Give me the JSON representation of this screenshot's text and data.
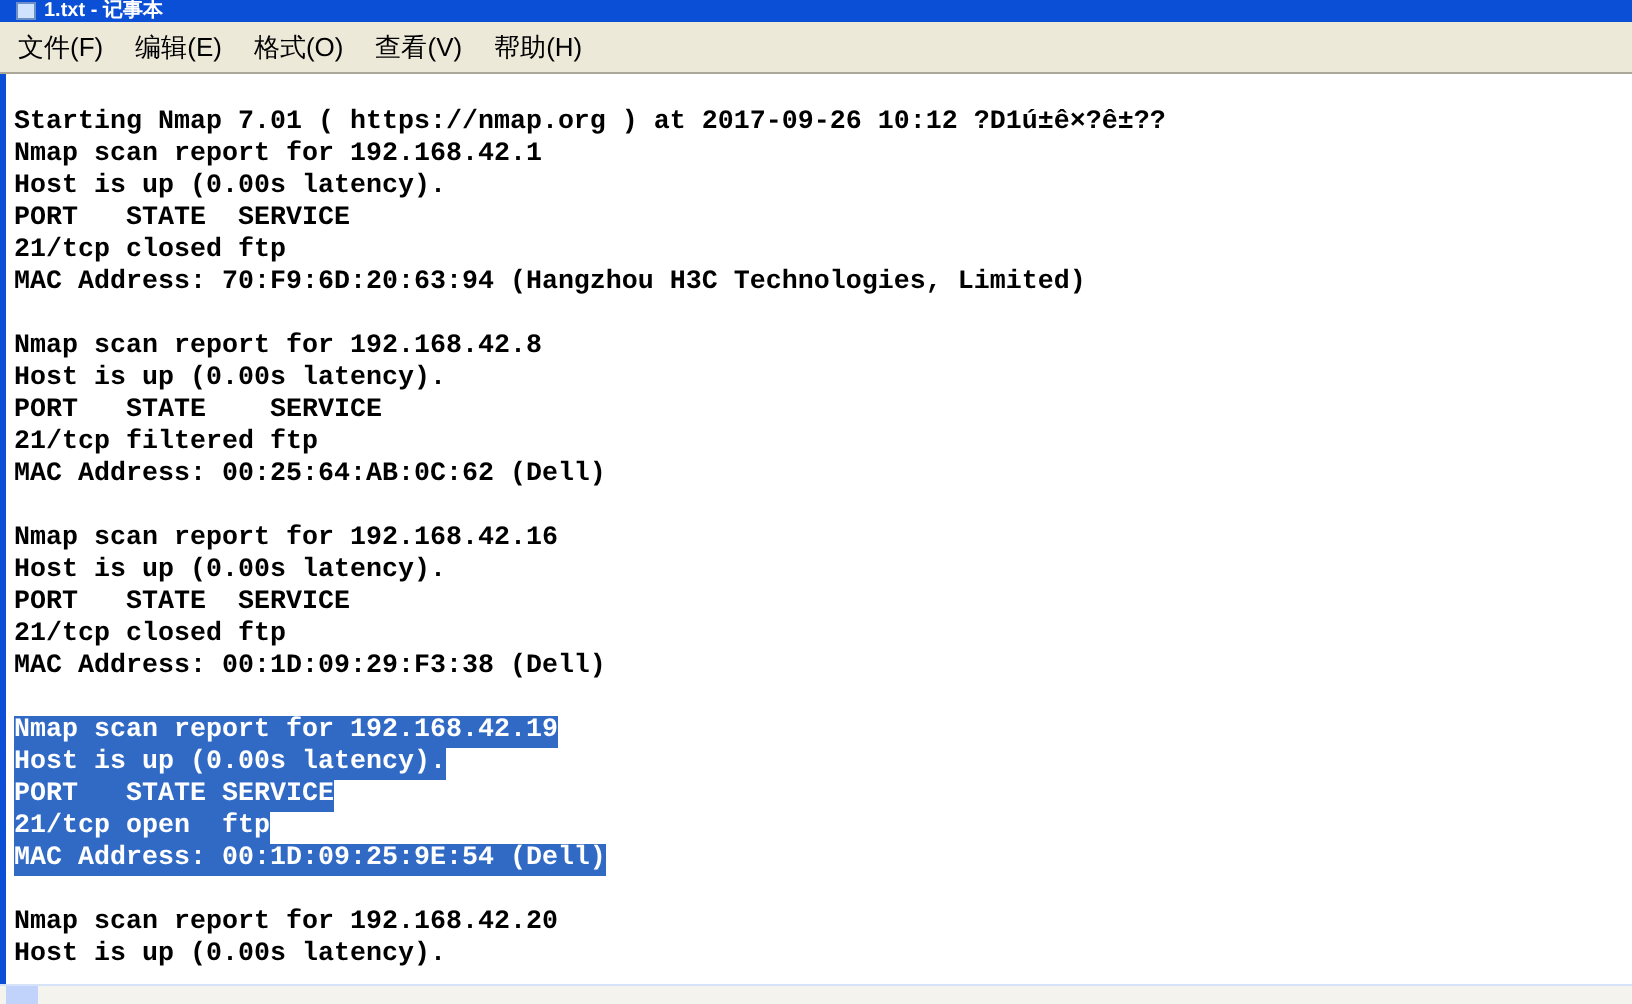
{
  "window": {
    "title": "1.txt - 记事本"
  },
  "menu": [
    "文件(F)",
    "编辑(E)",
    "格式(O)",
    "查看(V)",
    "帮助(H)"
  ],
  "blocks": [
    {
      "lines": [
        {
          "text": "Starting Nmap 7.01 ( https://nmap.org ) at 2017-09-26 10:12 ?D1ú±ê×?ê±??",
          "selected": false
        },
        {
          "text": "Nmap scan report for 192.168.42.1",
          "selected": false
        },
        {
          "text": "Host is up (0.00s latency).",
          "selected": false
        },
        {
          "text": "PORT   STATE  SERVICE",
          "selected": false
        },
        {
          "text": "21/tcp closed ftp",
          "selected": false
        },
        {
          "text": "MAC Address: 70:F9:6D:20:63:94 (Hangzhou H3C Technologies, Limited)",
          "selected": false
        }
      ]
    },
    {
      "lines": [
        {
          "text": "Nmap scan report for 192.168.42.8",
          "selected": false
        },
        {
          "text": "Host is up (0.00s latency).",
          "selected": false
        },
        {
          "text": "PORT   STATE    SERVICE",
          "selected": false
        },
        {
          "text": "21/tcp filtered ftp",
          "selected": false
        },
        {
          "text": "MAC Address: 00:25:64:AB:0C:62 (Dell)",
          "selected": false
        }
      ]
    },
    {
      "lines": [
        {
          "text": "Nmap scan report for 192.168.42.16",
          "selected": false
        },
        {
          "text": "Host is up (0.00s latency).",
          "selected": false
        },
        {
          "text": "PORT   STATE  SERVICE",
          "selected": false
        },
        {
          "text": "21/tcp closed ftp",
          "selected": false
        },
        {
          "text": "MAC Address: 00:1D:09:29:F3:38 (Dell)",
          "selected": false
        }
      ]
    },
    {
      "lines": [
        {
          "text": "Nmap scan report for 192.168.42.19",
          "selected": true
        },
        {
          "text": "Host is up (0.00s latency).",
          "selected": true
        },
        {
          "text": "PORT   STATE SERVICE",
          "selected": true
        },
        {
          "text": "21/tcp open  ftp",
          "selected": true
        },
        {
          "text": "MAC Address: 00:1D:09:25:9E:54 (Dell)",
          "selected": true
        }
      ]
    },
    {
      "lines": [
        {
          "text": "Nmap scan report for 192.168.42.20",
          "selected": false
        },
        {
          "text": "Host is up (0.00s latency).",
          "selected": false
        }
      ]
    }
  ]
}
